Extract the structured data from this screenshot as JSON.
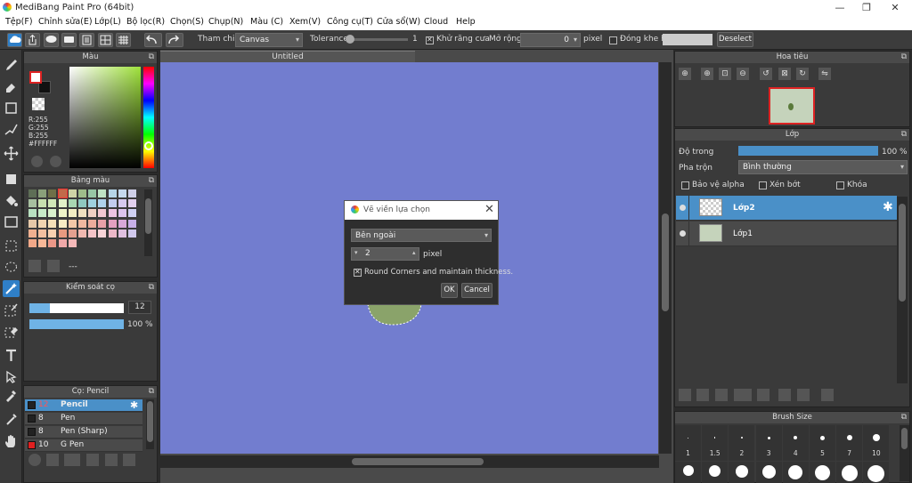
{
  "window": {
    "title": "MediBang Paint Pro (64bit)"
  },
  "menu": [
    "Tệp(F)",
    "Chỉnh sửa(E)",
    "Lớp(L)",
    "Bộ lọc(R)",
    "Chọn(S)",
    "Chụp(N)",
    "Màu (C)",
    "Xem(V)",
    "Công cụ(T)",
    "Cửa sổ(W)",
    "Cloud",
    "Help"
  ],
  "toolbar": {
    "ref_label": "Tham chiếu",
    "ref_value": "Canvas",
    "tolerance_label": "Tolerance",
    "tolerance_value": "1",
    "antialias_label": "Khử răng cưa",
    "expand_label": "Mở rộng",
    "expand_value": "0",
    "expand_unit": "pixel",
    "gap_label": "Đóng khe hở",
    "deselect_label": "Deselect"
  },
  "color_panel": {
    "title": "Màu",
    "r": "R:255",
    "g": "G:255",
    "b": "B:255",
    "hex": "#FFFFFF"
  },
  "palette_panel": {
    "title": "Bảng màu",
    "dashes": "---"
  },
  "brush_control": {
    "title": "Kiểm soát cọ",
    "size": "12",
    "opacity": "100 %",
    "size_fraction": 0.22,
    "opacity_fraction": 1.0
  },
  "brush_panel": {
    "title": "Cọ: Pencil",
    "items": [
      {
        "size": "12",
        "name": "Pencil",
        "color": "#222222",
        "selected": true
      },
      {
        "size": "8",
        "name": "Pen",
        "color": "#222222",
        "selected": false
      },
      {
        "size": "8",
        "name": "Pen (Sharp)",
        "color": "#222222",
        "selected": false
      },
      {
        "size": "10",
        "name": "G Pen",
        "color": "#e02020",
        "selected": false
      }
    ]
  },
  "document": {
    "tab": "Untitled"
  },
  "dialog": {
    "title": "Vẽ viền lựa chọn",
    "position_value": "Bên ngoài",
    "width_value": "2",
    "width_unit": "pixel",
    "round_label": "Round Corners and maintain thickness.",
    "ok": "OK",
    "cancel": "Cancel"
  },
  "navigator": {
    "title": "Hoa tiêu"
  },
  "layer_panel": {
    "title": "Lớp",
    "opacity_label": "Độ trong",
    "opacity_value": "100 %",
    "opacity_fraction": 1.0,
    "blend_label": "Pha trộn",
    "blend_value": "Bình thường",
    "protect_alpha": "Bảo vệ alpha",
    "clipping": "Xén bớt",
    "lock": "Khóa",
    "layers": [
      {
        "name": "Lớp2",
        "selected": true
      },
      {
        "name": "Lớp1",
        "selected": false
      }
    ]
  },
  "brush_size_panel": {
    "title": "Brush Size",
    "sizes": [
      "1",
      "1.5",
      "2",
      "3",
      "4",
      "5",
      "7",
      "10"
    ]
  },
  "colors": {
    "canvas": "#727dcf",
    "accent": "#4a90c8",
    "green_shape": "#8aa36a"
  }
}
